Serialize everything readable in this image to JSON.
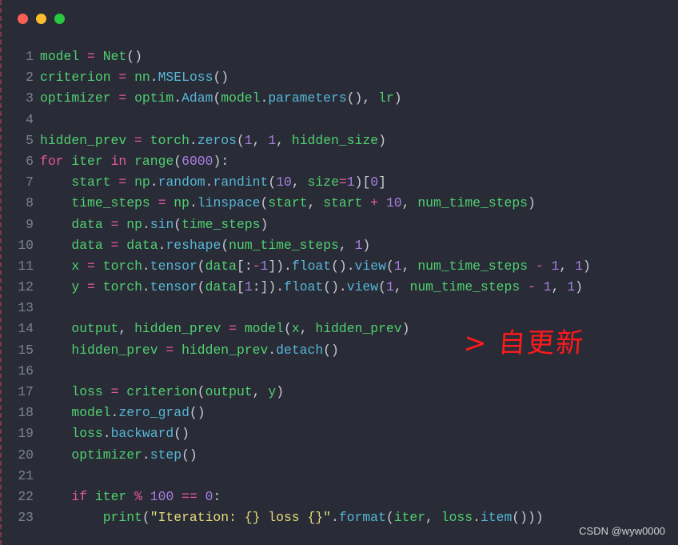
{
  "window": {
    "controls": [
      {
        "name": "close",
        "color": "#fe5f57"
      },
      {
        "name": "minimize",
        "color": "#febc2e"
      },
      {
        "name": "maximize",
        "color": "#29c840"
      }
    ]
  },
  "code": {
    "language": "python",
    "lines": [
      {
        "n": "1",
        "tokens": [
          [
            "id",
            "model"
          ],
          [
            "pun",
            " "
          ],
          [
            "op",
            "="
          ],
          [
            "pun",
            " "
          ],
          [
            "id",
            "Net"
          ],
          [
            "pun",
            "()"
          ]
        ]
      },
      {
        "n": "2",
        "tokens": [
          [
            "id",
            "criterion"
          ],
          [
            "pun",
            " "
          ],
          [
            "op",
            "="
          ],
          [
            "pun",
            " "
          ],
          [
            "id",
            "nn"
          ],
          [
            "pun",
            "."
          ],
          [
            "fn",
            "MSELoss"
          ],
          [
            "pun",
            "()"
          ]
        ]
      },
      {
        "n": "3",
        "tokens": [
          [
            "id",
            "optimizer"
          ],
          [
            "pun",
            " "
          ],
          [
            "op",
            "="
          ],
          [
            "pun",
            " "
          ],
          [
            "id",
            "optim"
          ],
          [
            "pun",
            "."
          ],
          [
            "fn",
            "Adam"
          ],
          [
            "pun",
            "("
          ],
          [
            "id",
            "model"
          ],
          [
            "pun",
            "."
          ],
          [
            "fn",
            "parameters"
          ],
          [
            "pun",
            "(), "
          ],
          [
            "id",
            "lr"
          ],
          [
            "pun",
            ")"
          ]
        ]
      },
      {
        "n": "4",
        "tokens": []
      },
      {
        "n": "5",
        "tokens": [
          [
            "id",
            "hidden_prev"
          ],
          [
            "pun",
            " "
          ],
          [
            "op",
            "="
          ],
          [
            "pun",
            " "
          ],
          [
            "id",
            "torch"
          ],
          [
            "pun",
            "."
          ],
          [
            "fn",
            "zeros"
          ],
          [
            "pun",
            "("
          ],
          [
            "num",
            "1"
          ],
          [
            "pun",
            ", "
          ],
          [
            "num",
            "1"
          ],
          [
            "pun",
            ", "
          ],
          [
            "id",
            "hidden_size"
          ],
          [
            "pun",
            ")"
          ]
        ]
      },
      {
        "n": "6",
        "tokens": [
          [
            "kw",
            "for"
          ],
          [
            "pun",
            " "
          ],
          [
            "id",
            "iter"
          ],
          [
            "pun",
            " "
          ],
          [
            "kw",
            "in"
          ],
          [
            "pun",
            " "
          ],
          [
            "id",
            "range"
          ],
          [
            "pun",
            "("
          ],
          [
            "num",
            "6000"
          ],
          [
            "pun",
            "):"
          ]
        ]
      },
      {
        "n": "7",
        "tokens": [
          [
            "pun",
            "    "
          ],
          [
            "id",
            "start"
          ],
          [
            "pun",
            " "
          ],
          [
            "op",
            "="
          ],
          [
            "pun",
            " "
          ],
          [
            "id",
            "np"
          ],
          [
            "pun",
            "."
          ],
          [
            "fn",
            "random"
          ],
          [
            "pun",
            "."
          ],
          [
            "fn",
            "randint"
          ],
          [
            "pun",
            "("
          ],
          [
            "num",
            "10"
          ],
          [
            "pun",
            ", "
          ],
          [
            "id",
            "size"
          ],
          [
            "op",
            "="
          ],
          [
            "num",
            "1"
          ],
          [
            "pun",
            ")["
          ],
          [
            "num",
            "0"
          ],
          [
            "pun",
            "]"
          ]
        ]
      },
      {
        "n": "8",
        "tokens": [
          [
            "pun",
            "    "
          ],
          [
            "id",
            "time_steps"
          ],
          [
            "pun",
            " "
          ],
          [
            "op",
            "="
          ],
          [
            "pun",
            " "
          ],
          [
            "id",
            "np"
          ],
          [
            "pun",
            "."
          ],
          [
            "fn",
            "linspace"
          ],
          [
            "pun",
            "("
          ],
          [
            "id",
            "start"
          ],
          [
            "pun",
            ", "
          ],
          [
            "id",
            "start"
          ],
          [
            "pun",
            " "
          ],
          [
            "op",
            "+"
          ],
          [
            "pun",
            " "
          ],
          [
            "num",
            "10"
          ],
          [
            "pun",
            ", "
          ],
          [
            "id",
            "num_time_steps"
          ],
          [
            "pun",
            ")"
          ]
        ]
      },
      {
        "n": "9",
        "tokens": [
          [
            "pun",
            "    "
          ],
          [
            "id",
            "data"
          ],
          [
            "pun",
            " "
          ],
          [
            "op",
            "="
          ],
          [
            "pun",
            " "
          ],
          [
            "id",
            "np"
          ],
          [
            "pun",
            "."
          ],
          [
            "fn",
            "sin"
          ],
          [
            "pun",
            "("
          ],
          [
            "id",
            "time_steps"
          ],
          [
            "pun",
            ")"
          ]
        ]
      },
      {
        "n": "10",
        "tokens": [
          [
            "pun",
            "    "
          ],
          [
            "id",
            "data"
          ],
          [
            "pun",
            " "
          ],
          [
            "op",
            "="
          ],
          [
            "pun",
            " "
          ],
          [
            "id",
            "data"
          ],
          [
            "pun",
            "."
          ],
          [
            "fn",
            "reshape"
          ],
          [
            "pun",
            "("
          ],
          [
            "id",
            "num_time_steps"
          ],
          [
            "pun",
            ", "
          ],
          [
            "num",
            "1"
          ],
          [
            "pun",
            ")"
          ]
        ]
      },
      {
        "n": "11",
        "tokens": [
          [
            "pun",
            "    "
          ],
          [
            "id",
            "x"
          ],
          [
            "pun",
            " "
          ],
          [
            "op",
            "="
          ],
          [
            "pun",
            " "
          ],
          [
            "id",
            "torch"
          ],
          [
            "pun",
            "."
          ],
          [
            "fn",
            "tensor"
          ],
          [
            "pun",
            "("
          ],
          [
            "id",
            "data"
          ],
          [
            "pun",
            "[:"
          ],
          [
            "op",
            "-"
          ],
          [
            "num",
            "1"
          ],
          [
            "pun",
            "])."
          ],
          [
            "fn",
            "float"
          ],
          [
            "pun",
            "()."
          ],
          [
            "fn",
            "view"
          ],
          [
            "pun",
            "("
          ],
          [
            "num",
            "1"
          ],
          [
            "pun",
            ", "
          ],
          [
            "id",
            "num_time_steps"
          ],
          [
            "pun",
            " "
          ],
          [
            "op",
            "-"
          ],
          [
            "pun",
            " "
          ],
          [
            "num",
            "1"
          ],
          [
            "pun",
            ", "
          ],
          [
            "num",
            "1"
          ],
          [
            "pun",
            ")"
          ]
        ]
      },
      {
        "n": "12",
        "tokens": [
          [
            "pun",
            "    "
          ],
          [
            "id",
            "y"
          ],
          [
            "pun",
            " "
          ],
          [
            "op",
            "="
          ],
          [
            "pun",
            " "
          ],
          [
            "id",
            "torch"
          ],
          [
            "pun",
            "."
          ],
          [
            "fn",
            "tensor"
          ],
          [
            "pun",
            "("
          ],
          [
            "id",
            "data"
          ],
          [
            "pun",
            "["
          ],
          [
            "num",
            "1"
          ],
          [
            "pun",
            ":])."
          ],
          [
            "fn",
            "float"
          ],
          [
            "pun",
            "()."
          ],
          [
            "fn",
            "view"
          ],
          [
            "pun",
            "("
          ],
          [
            "num",
            "1"
          ],
          [
            "pun",
            ", "
          ],
          [
            "id",
            "num_time_steps"
          ],
          [
            "pun",
            " "
          ],
          [
            "op",
            "-"
          ],
          [
            "pun",
            " "
          ],
          [
            "num",
            "1"
          ],
          [
            "pun",
            ", "
          ],
          [
            "num",
            "1"
          ],
          [
            "pun",
            ")"
          ]
        ]
      },
      {
        "n": "13",
        "tokens": []
      },
      {
        "n": "14",
        "tokens": [
          [
            "pun",
            "    "
          ],
          [
            "id",
            "output"
          ],
          [
            "pun",
            ", "
          ],
          [
            "id",
            "hidden_prev"
          ],
          [
            "pun",
            " "
          ],
          [
            "op",
            "="
          ],
          [
            "pun",
            " "
          ],
          [
            "id",
            "model"
          ],
          [
            "pun",
            "("
          ],
          [
            "id",
            "x"
          ],
          [
            "pun",
            ", "
          ],
          [
            "id",
            "hidden_prev"
          ],
          [
            "pun",
            ")"
          ]
        ]
      },
      {
        "n": "15",
        "tokens": [
          [
            "pun",
            "    "
          ],
          [
            "id",
            "hidden_prev"
          ],
          [
            "pun",
            " "
          ],
          [
            "op",
            "="
          ],
          [
            "pun",
            " "
          ],
          [
            "id",
            "hidden_prev"
          ],
          [
            "pun",
            "."
          ],
          [
            "fn",
            "detach"
          ],
          [
            "pun",
            "()"
          ]
        ]
      },
      {
        "n": "16",
        "tokens": []
      },
      {
        "n": "17",
        "tokens": [
          [
            "pun",
            "    "
          ],
          [
            "id",
            "loss"
          ],
          [
            "pun",
            " "
          ],
          [
            "op",
            "="
          ],
          [
            "pun",
            " "
          ],
          [
            "id",
            "criterion"
          ],
          [
            "pun",
            "("
          ],
          [
            "id",
            "output"
          ],
          [
            "pun",
            ", "
          ],
          [
            "id",
            "y"
          ],
          [
            "pun",
            ")"
          ]
        ]
      },
      {
        "n": "18",
        "tokens": [
          [
            "pun",
            "    "
          ],
          [
            "id",
            "model"
          ],
          [
            "pun",
            "."
          ],
          [
            "fn",
            "zero_grad"
          ],
          [
            "pun",
            "()"
          ]
        ]
      },
      {
        "n": "19",
        "tokens": [
          [
            "pun",
            "    "
          ],
          [
            "id",
            "loss"
          ],
          [
            "pun",
            "."
          ],
          [
            "fn",
            "backward"
          ],
          [
            "pun",
            "()"
          ]
        ]
      },
      {
        "n": "20",
        "tokens": [
          [
            "pun",
            "    "
          ],
          [
            "id",
            "optimizer"
          ],
          [
            "pun",
            "."
          ],
          [
            "fn",
            "step"
          ],
          [
            "pun",
            "()"
          ]
        ]
      },
      {
        "n": "21",
        "tokens": []
      },
      {
        "n": "22",
        "tokens": [
          [
            "pun",
            "    "
          ],
          [
            "kw",
            "if"
          ],
          [
            "pun",
            " "
          ],
          [
            "id",
            "iter"
          ],
          [
            "pun",
            " "
          ],
          [
            "op",
            "%"
          ],
          [
            "pun",
            " "
          ],
          [
            "num",
            "100"
          ],
          [
            "pun",
            " "
          ],
          [
            "op",
            "=="
          ],
          [
            "pun",
            " "
          ],
          [
            "num",
            "0"
          ],
          [
            "pun",
            ":"
          ]
        ]
      },
      {
        "n": "23",
        "tokens": [
          [
            "pun",
            "        "
          ],
          [
            "id",
            "print"
          ],
          [
            "pun",
            "("
          ],
          [
            "str",
            "\"Iteration: {} loss {}\""
          ],
          [
            "pun",
            "."
          ],
          [
            "fn",
            "format"
          ],
          [
            "pun",
            "("
          ],
          [
            "id",
            "iter"
          ],
          [
            "pun",
            ", "
          ],
          [
            "id",
            "loss"
          ],
          [
            "pun",
            "."
          ],
          [
            "fn",
            "item"
          ],
          [
            "pun",
            "()))"
          ]
        ]
      }
    ]
  },
  "annotation": {
    "text": "> 自更新",
    "color": "#ff1a1a"
  },
  "watermark": {
    "text": "CSDN @wyw0000"
  }
}
